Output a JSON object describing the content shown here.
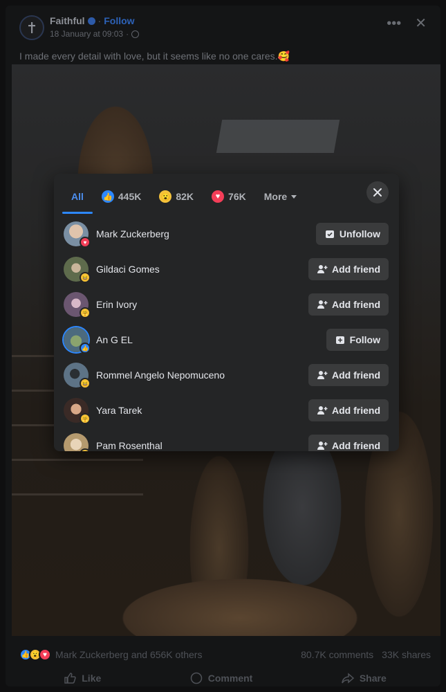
{
  "post": {
    "page_name": "Faithful",
    "follow_label": "Follow",
    "timestamp": "18 January at 09:03",
    "separator": "·",
    "caption": "I made every detail with love, but it seems like no one cares.🥰",
    "icons": {
      "more": "more-icon",
      "close": "close-icon",
      "globe": "globe-icon",
      "verified": "verified-badge-icon"
    }
  },
  "reactions_summary": {
    "text": "Mark Zuckerberg and 656K others",
    "comments": "80.7K comments",
    "shares": "33K shares"
  },
  "actions": {
    "like": "Like",
    "comment": "Comment",
    "share": "Share"
  },
  "modal": {
    "tabs": [
      {
        "label": "All"
      },
      {
        "label": "445K",
        "icon": "like-icon"
      },
      {
        "label": "82K",
        "icon": "wow-icon"
      },
      {
        "label": "76K",
        "icon": "love-icon"
      },
      {
        "label": "More",
        "icon": "caret-down-icon"
      }
    ],
    "people": [
      {
        "name": "Mark Zuckerberg",
        "reaction": "love",
        "button": "Unfollow",
        "button_icon": "unfollow-icon",
        "avatar_color": "#7a8fa3"
      },
      {
        "name": "Gildaci Gomes",
        "reaction": "haha",
        "button": "Add friend",
        "button_icon": "add-friend-icon",
        "avatar_color": "#5e6b4c"
      },
      {
        "name": "Erin Ivory",
        "reaction": "care",
        "button": "Add friend",
        "button_icon": "add-friend-icon",
        "avatar_color": "#6b5670"
      },
      {
        "name": "An G EL",
        "reaction": "like",
        "button": "Follow",
        "button_icon": "follow-icon",
        "avatar_color": "#4c6a7e"
      },
      {
        "name": "Rommel Angelo Nepomuceno",
        "reaction": "haha",
        "button": "Add friend",
        "button_icon": "add-friend-icon",
        "avatar_color": "#5d7386"
      },
      {
        "name": "Yara Tarek",
        "reaction": "care",
        "button": "Add friend",
        "button_icon": "add-friend-icon",
        "avatar_color": "#3a2a26"
      },
      {
        "name": "Pam Rosenthal",
        "reaction": "care",
        "button": "Add friend",
        "button_icon": "add-friend-icon",
        "avatar_color": "#b59a6e"
      }
    ]
  },
  "colors": {
    "accent": "#2d88ff",
    "modal_bg": "#242526",
    "button_bg": "#3a3b3c",
    "like": "#2d88ff",
    "love": "#f33e58",
    "wow": "#f5c33b"
  }
}
